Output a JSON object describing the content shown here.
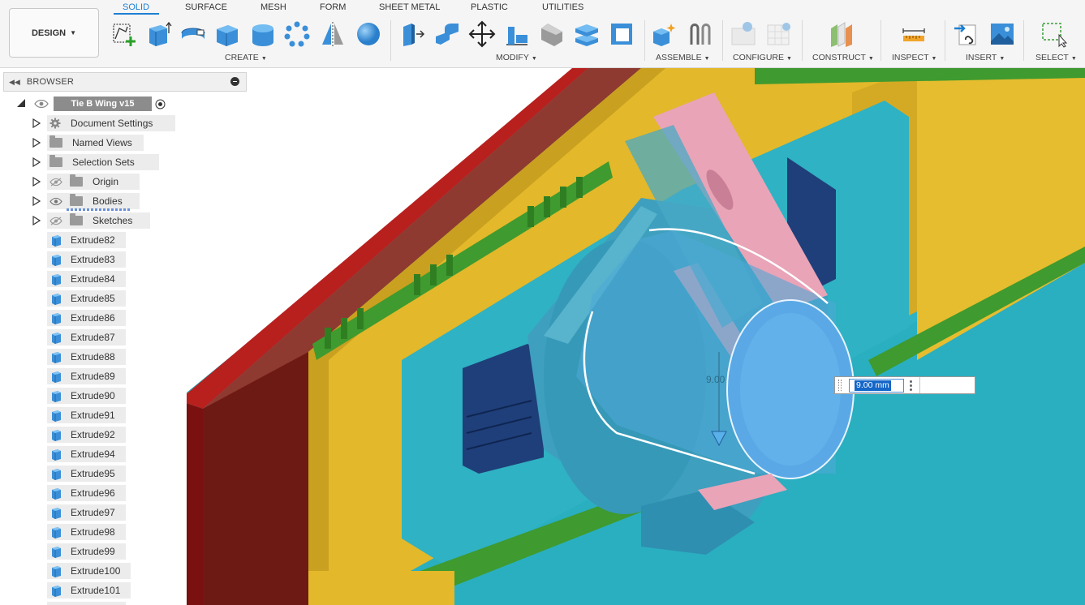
{
  "toolbar": {
    "workspace_label": "DESIGN",
    "tabs": [
      {
        "label": "SOLID",
        "active": true
      },
      {
        "label": "SURFACE",
        "active": false
      },
      {
        "label": "MESH",
        "active": false
      },
      {
        "label": "FORM",
        "active": false
      },
      {
        "label": "SHEET METAL",
        "active": false
      },
      {
        "label": "PLASTIC",
        "active": false
      },
      {
        "label": "UTILITIES",
        "active": false
      }
    ],
    "groups": {
      "create": "CREATE",
      "modify": "MODIFY",
      "assemble": "ASSEMBLE",
      "configure": "CONFIGURE",
      "construct": "CONSTRUCT",
      "inspect": "INSPECT",
      "insert": "INSERT",
      "select": "SELECT"
    },
    "tool_icons": {
      "create": [
        "create-sketch-icon",
        "extrude-icon",
        "revolve-icon",
        "box-icon",
        "cylinder-icon",
        "pattern-icon",
        "mirror-icon",
        "sphere-icon"
      ],
      "modify": [
        "press-pull-icon",
        "fillet-icon",
        "move-icon",
        "align-icon",
        "chamfer-icon",
        "split-body-icon",
        "shell-icon"
      ],
      "assemble": [
        "new-component-icon",
        "joint-icon"
      ],
      "configure": [
        "configure-table-icon",
        "configure-rule-icon"
      ],
      "construct": [
        "offset-plane-icon"
      ],
      "inspect": [
        "measure-icon"
      ],
      "insert": [
        "insert-derive-icon",
        "insert-image-icon"
      ],
      "select": [
        "select-window-icon"
      ]
    }
  },
  "browser": {
    "title": "BROWSER",
    "root": {
      "label": "Tie B Wing v15"
    },
    "folders": [
      {
        "label": "Document Settings",
        "icon": "gear-icon",
        "eye": null
      },
      {
        "label": "Named Views",
        "icon": "folder-icon",
        "eye": null
      },
      {
        "label": "Selection Sets",
        "icon": "folder-icon",
        "eye": null
      },
      {
        "label": "Origin",
        "icon": "folder-icon",
        "eye": "hidden"
      },
      {
        "label": "Bodies",
        "icon": "folder-icon",
        "eye": "visible"
      },
      {
        "label": "Sketches",
        "icon": "folder-icon",
        "eye": "hidden"
      }
    ],
    "features": [
      "Extrude82",
      "Extrude83",
      "Extrude84",
      "Extrude85",
      "Extrude86",
      "Extrude87",
      "Extrude88",
      "Extrude89",
      "Extrude90",
      "Extrude91",
      "Extrude92",
      "Extrude94",
      "Extrude95",
      "Extrude96",
      "Extrude97",
      "Extrude98",
      "Extrude99",
      "Extrude100",
      "Extrude101"
    ]
  },
  "viewport": {
    "dimension_label": "9.00",
    "dimension_input_value": "9.00 mm",
    "colors": {
      "background": "#2aafc0",
      "panel_yellow": "#e3b82a",
      "panel_green": "#3f9a2f",
      "frame_red": "#b02020",
      "hub_blue": "#3e9fbe",
      "selected_face": "#5aa9e6",
      "pink_part": "#e9a4b8",
      "bracket_navy": "#1f3f7a"
    }
  }
}
